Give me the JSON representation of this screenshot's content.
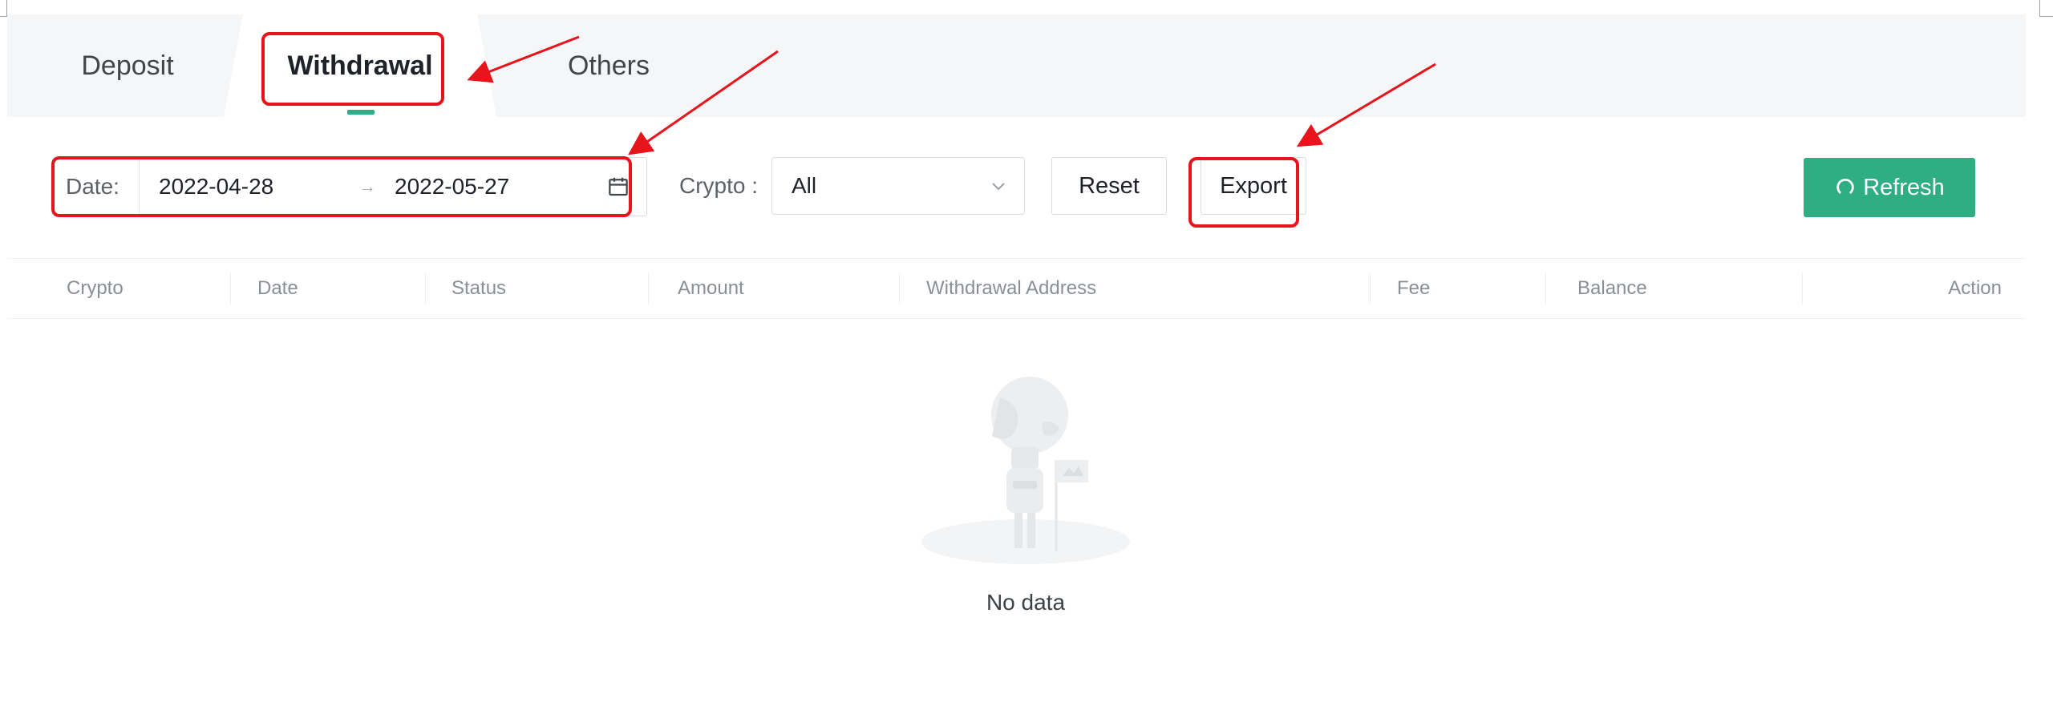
{
  "tabs": [
    {
      "label": "Deposit",
      "active": false
    },
    {
      "label": "Withdrawal",
      "active": true
    },
    {
      "label": "Others",
      "active": false
    }
  ],
  "filters": {
    "date_label": "Date",
    "date_start": "2022-04-28",
    "date_separator": "→",
    "date_end": "2022-05-27",
    "crypto_label": "Crypto",
    "crypto_value": "All"
  },
  "buttons": {
    "reset": "Reset",
    "export": "Export",
    "refresh": "Refresh"
  },
  "table": {
    "columns": [
      "Crypto",
      "Date",
      "Status",
      "Amount",
      "Withdrawal Address",
      "Fee",
      "Balance",
      "Action"
    ],
    "rows": []
  },
  "empty_state": {
    "text": "No data"
  },
  "icons": {
    "date_picker": "calendar-icon",
    "select": "chevron-down-icon",
    "refresh": "refresh-icon",
    "empty": "empty-illustration"
  },
  "colors": {
    "accent": "#2eae82",
    "annotation": "#e8141b",
    "tab_bar_bg": "#f4f6f7"
  }
}
